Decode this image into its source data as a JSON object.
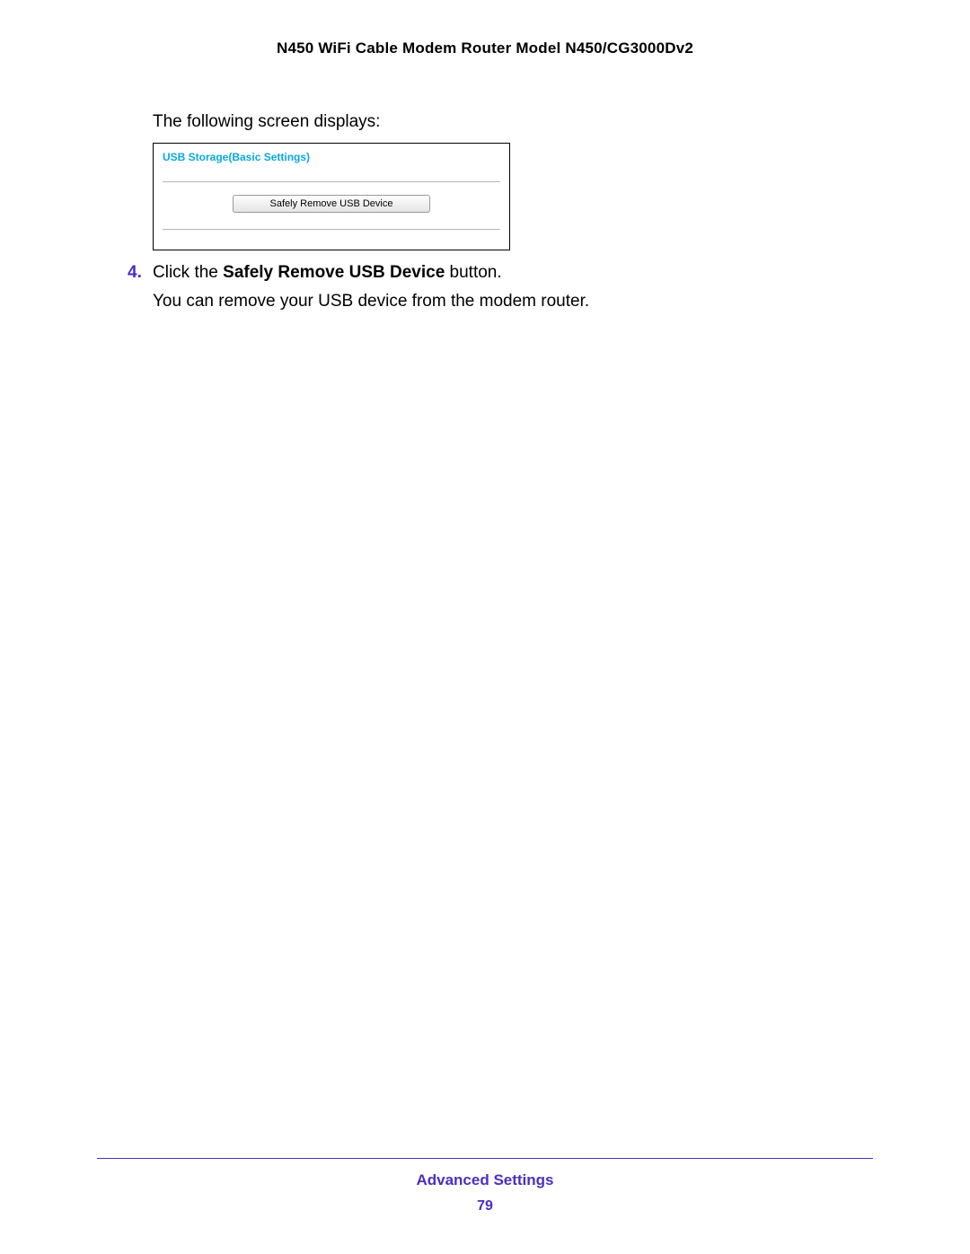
{
  "header": {
    "title": "N450 WiFi Cable Modem Router Model N450/CG3000Dv2"
  },
  "body": {
    "intro": "The following screen displays:",
    "screenshot": {
      "title": "USB Storage(Basic Settings)",
      "button_label": "Safely Remove USB Device"
    },
    "step": {
      "number": "4.",
      "prefix": "Click the ",
      "bold": "Safely Remove USB Device",
      "suffix": " button."
    },
    "followup": "You can remove your USB device from the modem router."
  },
  "footer": {
    "section": "Advanced Settings",
    "page": "79"
  }
}
